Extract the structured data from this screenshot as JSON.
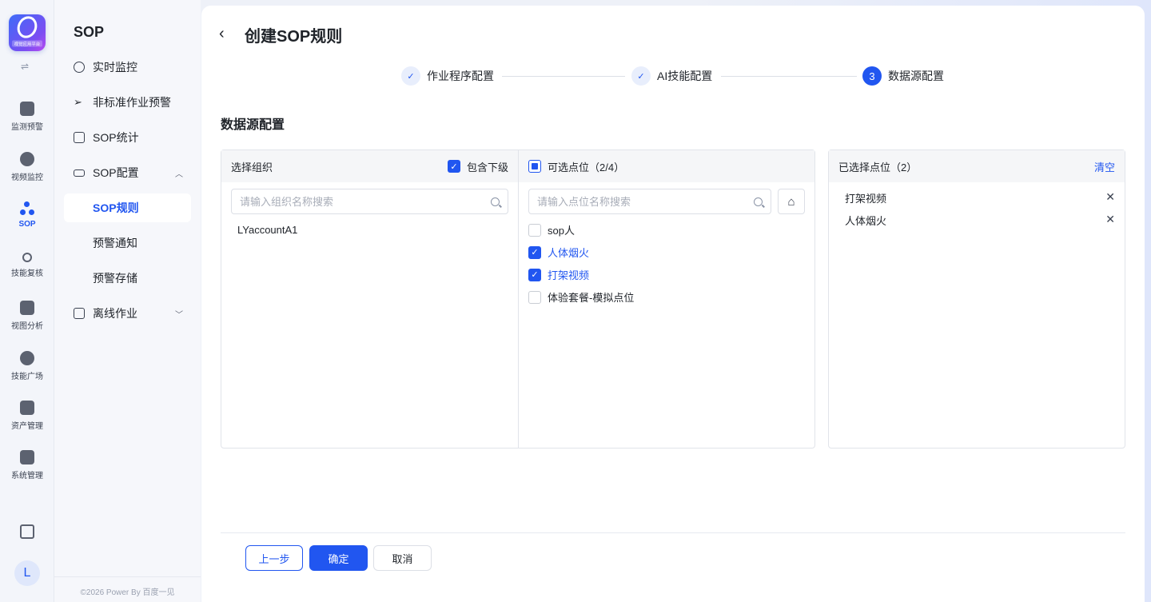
{
  "app": {
    "logo_caption": "视觉应用平台"
  },
  "rail": {
    "items": [
      {
        "label": "监测预警",
        "icon": "chart-monitor-icon"
      },
      {
        "label": "视频监控",
        "icon": "video-camera-icon"
      },
      {
        "label": "SOP",
        "icon": "sop-nodes-icon"
      },
      {
        "label": "技能复核",
        "icon": "target-icon"
      },
      {
        "label": "视图分析",
        "icon": "image-search-icon"
      },
      {
        "label": "技能广场",
        "icon": "cluster-icon"
      },
      {
        "label": "资产管理",
        "icon": "box-icon"
      },
      {
        "label": "系统管理",
        "icon": "settings-panel-icon"
      }
    ],
    "avatar_letter": "L"
  },
  "subnav": {
    "title": "SOP",
    "items": [
      {
        "label": "实时监控"
      },
      {
        "label": "非标准作业预警"
      },
      {
        "label": "SOP统计"
      },
      {
        "label": "SOP配置"
      },
      {
        "label": "SOP规则"
      },
      {
        "label": "预警通知"
      },
      {
        "label": "预警存储"
      },
      {
        "label": "离线作业"
      }
    ],
    "copyright": "©2026 Power By 百度一见"
  },
  "page": {
    "title": "创建SOP规则",
    "steps": [
      {
        "label": "作业程序配置",
        "status": "done"
      },
      {
        "label": "AI技能配置",
        "status": "done"
      },
      {
        "label": "数据源配置",
        "status": "current",
        "number": "3"
      }
    ],
    "section_title": "数据源配置"
  },
  "org_panel": {
    "header": "选择组织",
    "include_sub_label": "包含下级",
    "include_sub_checked": true,
    "search_placeholder": "请输入组织名称搜索",
    "orgs": [
      "LYaccountA1"
    ]
  },
  "points_panel": {
    "header": "可选点位（2/4）",
    "search_placeholder": "请输入点位名称搜索",
    "points": [
      {
        "label": "sop人",
        "checked": false
      },
      {
        "label": "人体烟火",
        "checked": true
      },
      {
        "label": "打架视频",
        "checked": true
      },
      {
        "label": "体验套餐-模拟点位",
        "checked": false
      }
    ]
  },
  "selected_panel": {
    "header": "已选择点位（2）",
    "clear_label": "清空",
    "items": [
      "打架视频",
      "人体烟火"
    ]
  },
  "footer": {
    "prev_label": "上一步",
    "ok_label": "确定",
    "cancel_label": "取消"
  },
  "colors": {
    "primary": "#2156f0",
    "border": "#e1e4ea"
  }
}
